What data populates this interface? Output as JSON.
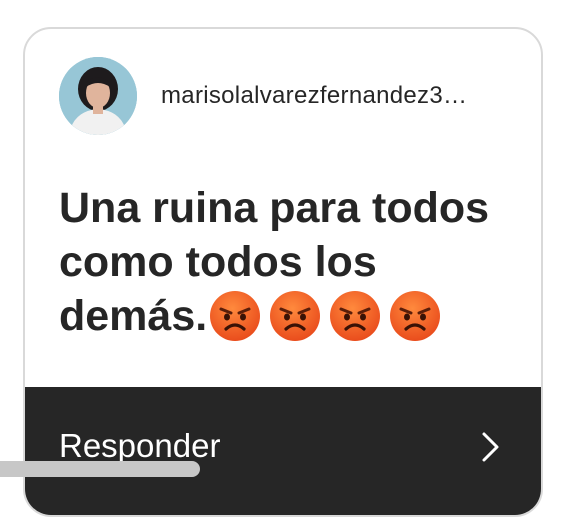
{
  "post": {
    "username": "marisolalvarezfernandez3…",
    "message": "Una ruina para todos como todos los demás.",
    "reactions": [
      "angry-face-emoji",
      "angry-face-emoji",
      "angry-face-emoji",
      "angry-face-emoji"
    ]
  },
  "reply": {
    "label": "Responder",
    "icon": "chevron-right-icon"
  },
  "colors": {
    "text": "#262626",
    "footer_bg": "#262626",
    "emoji": "#f25a1c"
  }
}
